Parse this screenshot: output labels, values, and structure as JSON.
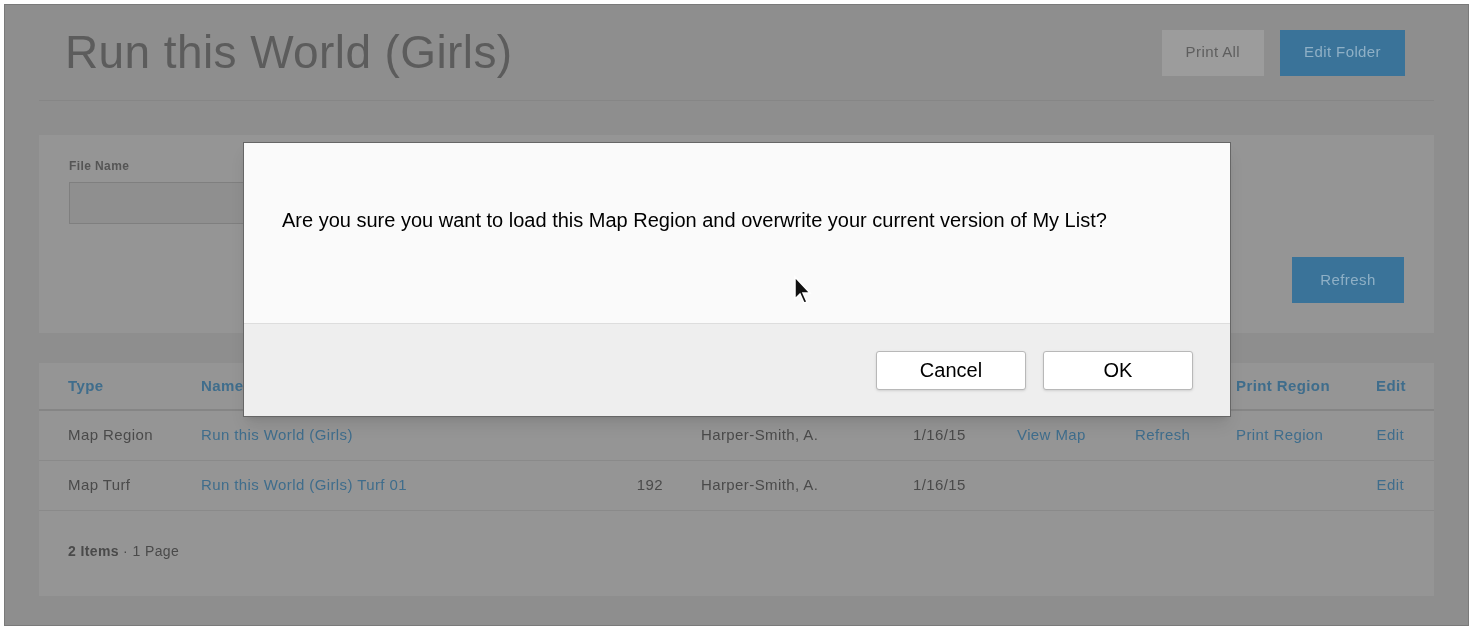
{
  "page": {
    "title": "Run this World (Girls)",
    "buttons": [
      {
        "label": "Print All",
        "kind": "secondary"
      },
      {
        "label": "Edit Folder",
        "kind": "primary"
      }
    ]
  },
  "filters": {
    "file_name_label": "File Name",
    "refresh_button": "Refresh"
  },
  "table": {
    "header": {
      "type": "Type",
      "name": "Name",
      "print": "Print Region",
      "edit": "Edit"
    },
    "rows": [
      {
        "type": "Map Region",
        "name": "Run this World (Girls)",
        "owner": "Harper-Smith, A.",
        "date": "1/16/15",
        "view": "View Map",
        "refresh": "Refresh",
        "print": "Print Region",
        "edit": "Edit"
      },
      {
        "type": "Map Turf",
        "name": "Run this World (Girls) Turf 01",
        "parcels": "192",
        "owner": "Harper-Smith, A.",
        "date": "1/16/15",
        "edit": "Edit"
      }
    ],
    "footer_count": "2 Items",
    "footer_pages": "· 1 Page"
  },
  "dialog": {
    "message": "Are you sure you want to load this Map Region and overwrite your current version of My List?",
    "buttons": [
      "Cancel",
      "OK"
    ]
  }
}
